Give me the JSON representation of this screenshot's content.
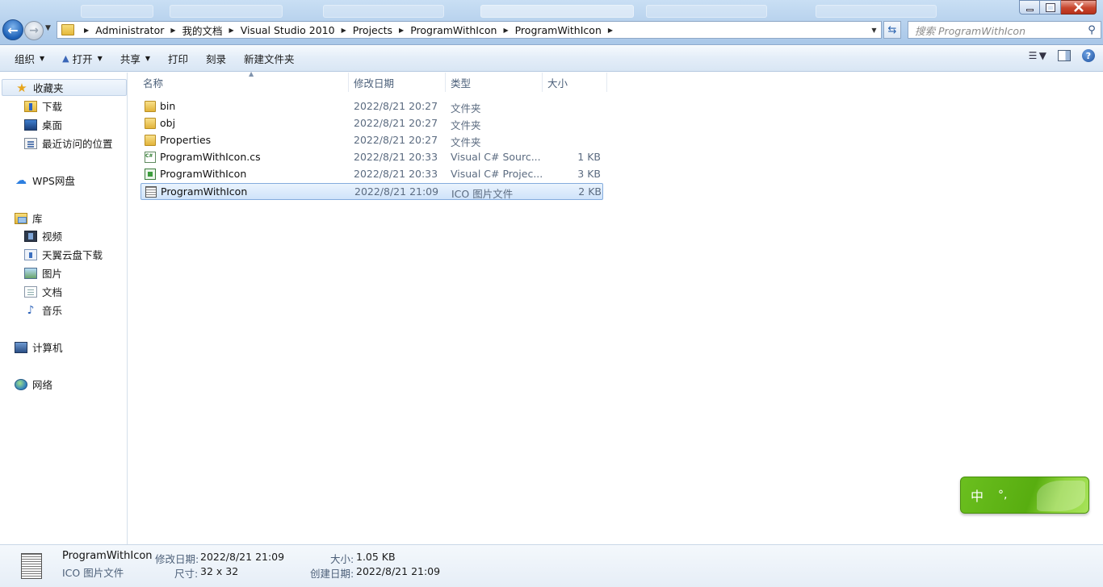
{
  "address": {
    "crumbs": [
      "Administrator",
      "我的文档",
      "Visual Studio 2010",
      "Projects",
      "ProgramWithIcon",
      "ProgramWithIcon"
    ],
    "search_placeholder": "搜索 ProgramWithIcon"
  },
  "toolbar": {
    "organize": "组织",
    "open": "打开",
    "share": "共享",
    "print": "打印",
    "burn": "刻录",
    "new_folder": "新建文件夹"
  },
  "nav": {
    "favorites": "收藏夹",
    "downloads": "下载",
    "desktop": "桌面",
    "recent": "最近访问的位置",
    "wps": "WPS网盘",
    "library": "库",
    "videos": "视频",
    "tianyi": "天翼云盘下载",
    "pictures": "图片",
    "documents": "文档",
    "music": "音乐",
    "computer": "计算机",
    "network": "网络"
  },
  "columns": {
    "name": "名称",
    "date": "修改日期",
    "type": "类型",
    "size": "大小"
  },
  "files": [
    {
      "name": "bin",
      "date": "2022/8/21 20:27",
      "type": "文件夹",
      "size": "",
      "icon": "folder-icon"
    },
    {
      "name": "obj",
      "date": "2022/8/21 20:27",
      "type": "文件夹",
      "size": "",
      "icon": "folder-icon"
    },
    {
      "name": "Properties",
      "date": "2022/8/21 20:27",
      "type": "文件夹",
      "size": "",
      "icon": "folder-icon"
    },
    {
      "name": "ProgramWithIcon.cs",
      "date": "2022/8/21 20:33",
      "type": "Visual C# Sourc...",
      "size": "1 KB",
      "icon": "csharp-file-icon"
    },
    {
      "name": "ProgramWithIcon",
      "date": "2022/8/21 20:33",
      "type": "Visual C# Projec...",
      "size": "3 KB",
      "icon": "csproj-file-icon"
    },
    {
      "name": "ProgramWithIcon",
      "date": "2022/8/21 21:09",
      "type": "ICO 图片文件",
      "size": "2 KB",
      "icon": "ico-file-icon",
      "selected": true
    }
  ],
  "ime": {
    "mode": "中",
    "punct": "°,"
  },
  "details": {
    "name": "ProgramWithIcon",
    "type": "ICO 图片文件",
    "modified_label": "修改日期:",
    "modified_value": "2022/8/21 21:09",
    "size_label": "大小:",
    "size_value": "1.05 KB",
    "dims_label": "尺寸:",
    "dims_value": "32 x 32",
    "created_label": "创建日期:",
    "created_value": "2022/8/21 21:09"
  }
}
